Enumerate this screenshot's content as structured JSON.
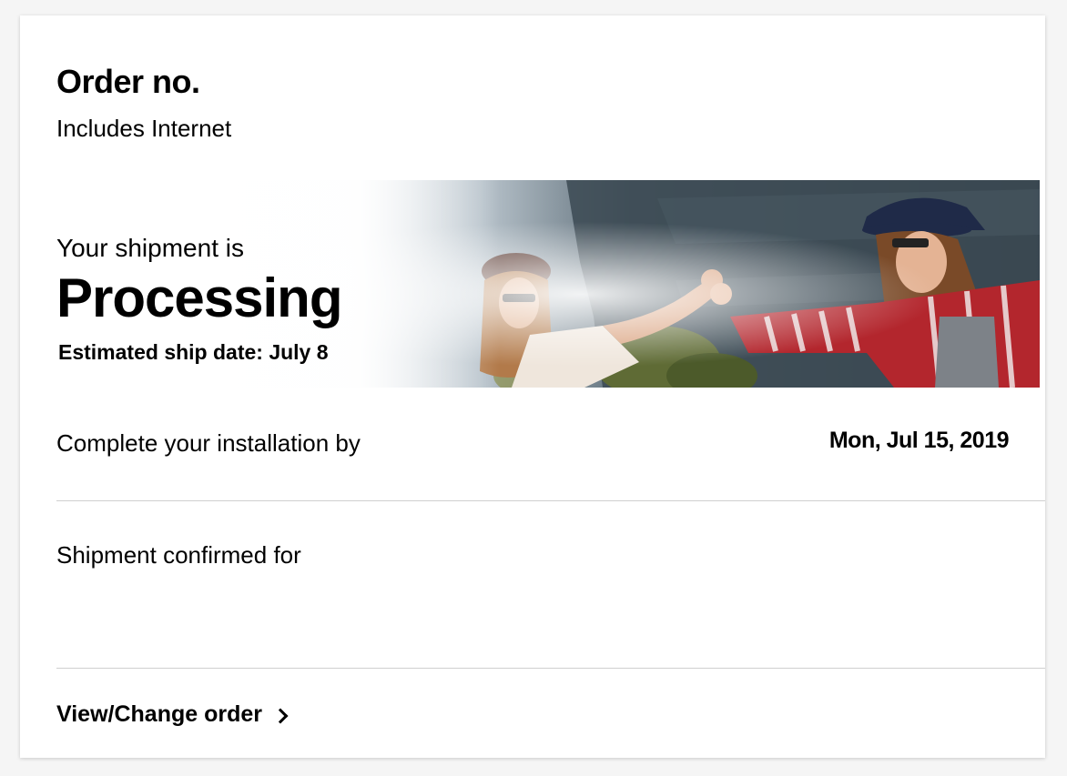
{
  "order": {
    "title": "Order no.",
    "subtitle": "Includes Internet"
  },
  "shipment_banner": {
    "kicker": "Your shipment is",
    "status": "Processing",
    "estimate": "Estimated ship date: July 8",
    "image": "photo-two-people-fist-bump-outdoors"
  },
  "installation": {
    "label": "Complete your installation by",
    "value": "Mon, Jul 15, 2019"
  },
  "shipment_confirmed": {
    "label": "Shipment confirmed for"
  },
  "actions": {
    "view_change_label": "View/Change order",
    "view_change_icon": "chevron-right-icon"
  },
  "colors": {
    "page_bg": "#f5f5f5",
    "card_bg": "#ffffff",
    "text": "#000000",
    "divider": "#cfcfcf"
  }
}
